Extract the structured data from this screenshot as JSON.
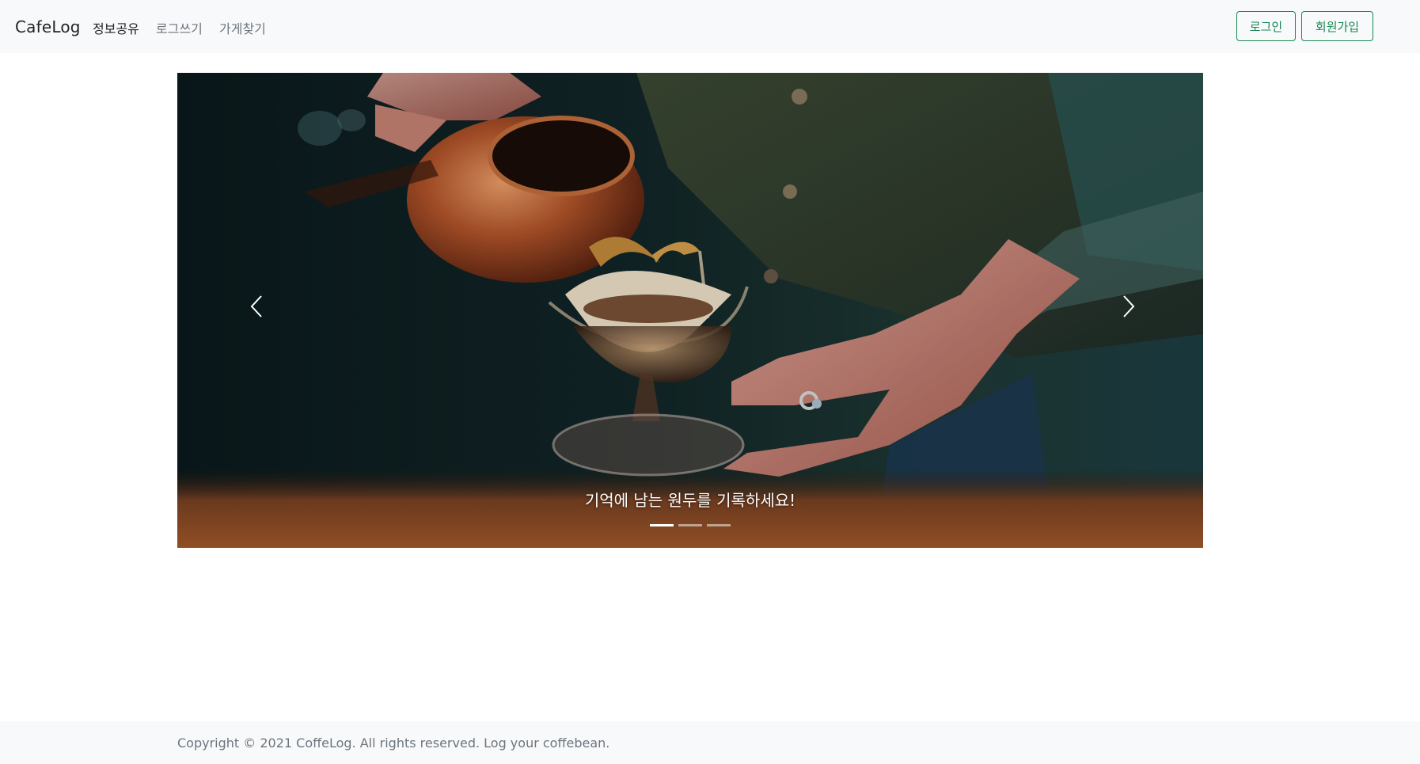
{
  "navbar": {
    "brand": "CafeLog",
    "links": [
      "정보공유",
      "로그쓰기",
      "가게찾기"
    ],
    "login_label": "로그인",
    "signup_label": "회원가입"
  },
  "carousel": {
    "caption": "기억에 남는 원두를 기록하세요!",
    "slide_count": 3,
    "active_index": 0
  },
  "footer": {
    "copyright": "Copyright © 2021 CoffeLog. All rights reserved. Log your coffebean."
  },
  "colors": {
    "accent": "#198754",
    "navbar_bg": "#f8f9fa",
    "muted_text": "#6c757d"
  }
}
